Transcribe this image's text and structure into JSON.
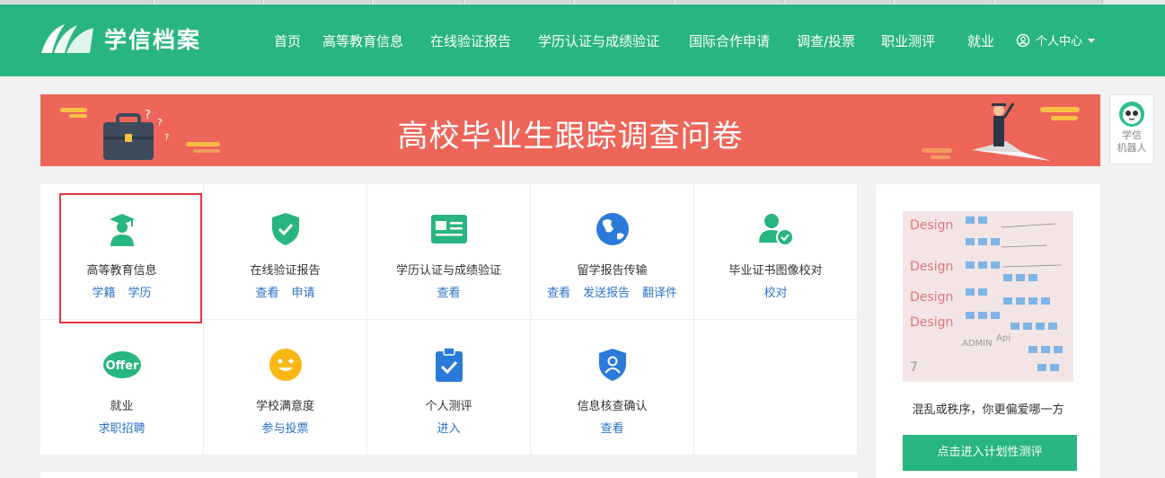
{
  "header": {
    "logo_text": "学信档案",
    "nav": [
      {
        "label": "首页"
      },
      {
        "label": "高等教育信息"
      },
      {
        "label": "在线验证报告"
      },
      {
        "label": "学历认证与成绩验证"
      },
      {
        "label": "国际合作申请"
      },
      {
        "label": "调查/投票"
      },
      {
        "label": "职业测评"
      },
      {
        "label": "就业"
      }
    ],
    "user_center": "个人中心"
  },
  "banner": {
    "title": "高校毕业生跟踪调查问卷"
  },
  "robot": {
    "line1": "学信",
    "line2": "机器人"
  },
  "services": [
    {
      "title": "高等教育信息",
      "links": [
        "学籍",
        "学历"
      ],
      "icon": "graduate-icon"
    },
    {
      "title": "在线验证报告",
      "links": [
        "查看",
        "申请"
      ],
      "icon": "shield-check-icon"
    },
    {
      "title": "学历认证与成绩验证",
      "links": [
        "查看"
      ],
      "icon": "certificate-card-icon"
    },
    {
      "title": "留学报告传输",
      "links": [
        "查看",
        "发送报告",
        "翻译件"
      ],
      "icon": "globe-icon"
    },
    {
      "title": "毕业证书图像校对",
      "links": [
        "校对"
      ],
      "icon": "user-check-icon"
    },
    {
      "title": "就业",
      "links": [
        "求职招聘"
      ],
      "icon": "offer-icon"
    },
    {
      "title": "学校满意度",
      "links": [
        "参与投票"
      ],
      "icon": "smiley-icon"
    },
    {
      "title": "个人测评",
      "links": [
        "进入"
      ],
      "icon": "clipboard-check-icon"
    },
    {
      "title": "信息核查确认",
      "links": [
        "查看"
      ],
      "icon": "shield-user-icon"
    }
  ],
  "offer_badge": "Offer",
  "side": {
    "caption": "混乱或秩序，你更偏爱哪一方",
    "button": "点击进入计划性测评"
  },
  "colors": {
    "brand": "#28b580",
    "banner": "#ee6559",
    "link": "#2b73c5",
    "highlight": "#e8363a"
  }
}
